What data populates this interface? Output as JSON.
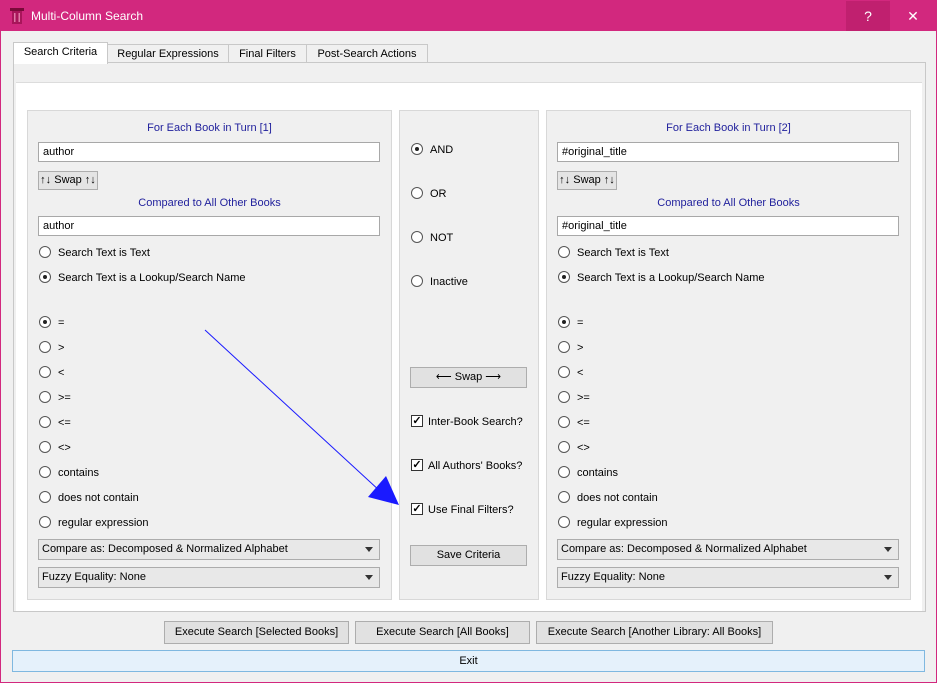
{
  "window": {
    "title": "Multi-Column Search",
    "help_label": "?",
    "close_label": "✕"
  },
  "tabs": [
    {
      "label": "Search Criteria"
    },
    {
      "label": "Regular Expressions"
    },
    {
      "label": "Final Filters"
    },
    {
      "label": "Post-Search Actions"
    }
  ],
  "left": {
    "header1": "For Each Book in Turn [1]",
    "field1": "author",
    "swap_label": "↑↓ Swap ↑↓",
    "header2": "Compared to All Other Books",
    "field2": "author",
    "mode_options": [
      "Search Text is Text",
      "Search Text is a Lookup/Search Name"
    ],
    "ops": [
      "=",
      ">",
      "<",
      ">=",
      "<=",
      "<>",
      "contains",
      "does not contain",
      "regular expression"
    ],
    "compare_as": "Compare as: Decomposed & Normalized Alphabet",
    "fuzzy": "Fuzzy Equality: None"
  },
  "middle": {
    "logic": [
      "AND",
      "OR",
      "NOT",
      "Inactive"
    ],
    "swap_label": "⟵ Swap ⟶",
    "checks": [
      "Inter-Book Search?",
      "All Authors' Books?",
      "Use Final Filters?"
    ],
    "save_label": "Save Criteria"
  },
  "right": {
    "header1": "For Each Book in Turn [2]",
    "field1": "#original_title",
    "swap_label": "↑↓ Swap ↑↓",
    "header2": "Compared to All Other Books",
    "field2": "#original_title",
    "mode_options": [
      "Search Text is Text",
      "Search Text is a Lookup/Search Name"
    ],
    "ops": [
      "=",
      ">",
      "<",
      ">=",
      "<=",
      "<>",
      "contains",
      "does not contain",
      "regular expression"
    ],
    "compare_as": "Compare as: Decomposed & Normalized Alphabet",
    "fuzzy": "Fuzzy Equality: None"
  },
  "bottom": {
    "exec_selected": "Execute Search [Selected Books]",
    "exec_all": "Execute Search [All Books]",
    "exec_library": "Execute Search [Another Library: All Books]",
    "exit": "Exit"
  },
  "colors": {
    "titlebar": "#d2287e",
    "header_text": "#1f1f9c",
    "annotation_arrow": "#1a1aff"
  }
}
